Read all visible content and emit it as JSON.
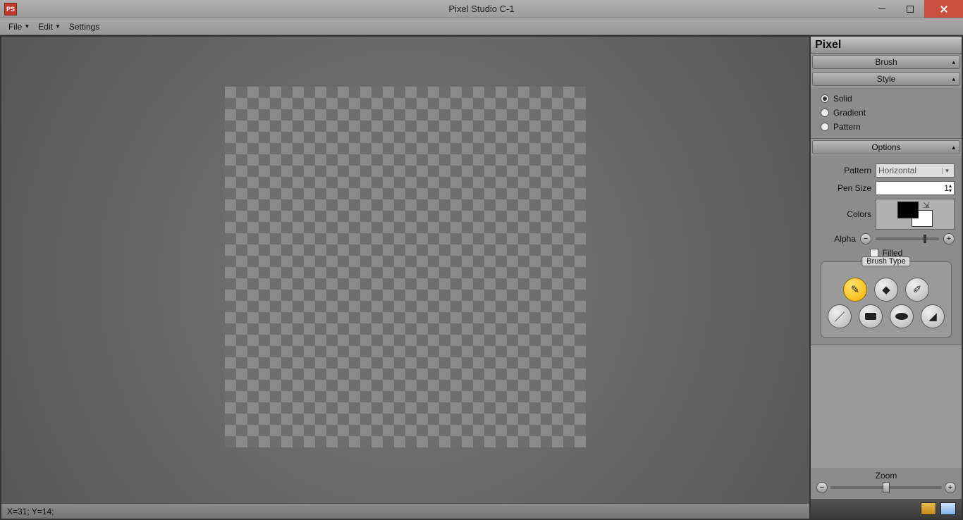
{
  "window": {
    "title": "Pixel Studio C-1",
    "app_icon_text": "PS"
  },
  "menu": {
    "file": "File",
    "edit": "Edit",
    "settings": "Settings"
  },
  "status": {
    "coords": "X=31; Y=14;"
  },
  "panel": {
    "title": "Pixel",
    "brush_header": "Brush",
    "style_header": "Style",
    "style_options": {
      "solid": "Solid",
      "gradient": "Gradient",
      "pattern": "Pattern"
    },
    "options_header": "Options",
    "labels": {
      "pattern": "Pattern",
      "pensize": "Pen Size",
      "colors": "Colors",
      "alpha": "Alpha",
      "filled": "Filled"
    },
    "pattern_value": "Horizontal",
    "pensize_value": "1",
    "colors": {
      "fg": "#000000",
      "bg": "#ffffff"
    },
    "brush_type_legend": "Brush Type",
    "zoom_label": "Zoom"
  }
}
